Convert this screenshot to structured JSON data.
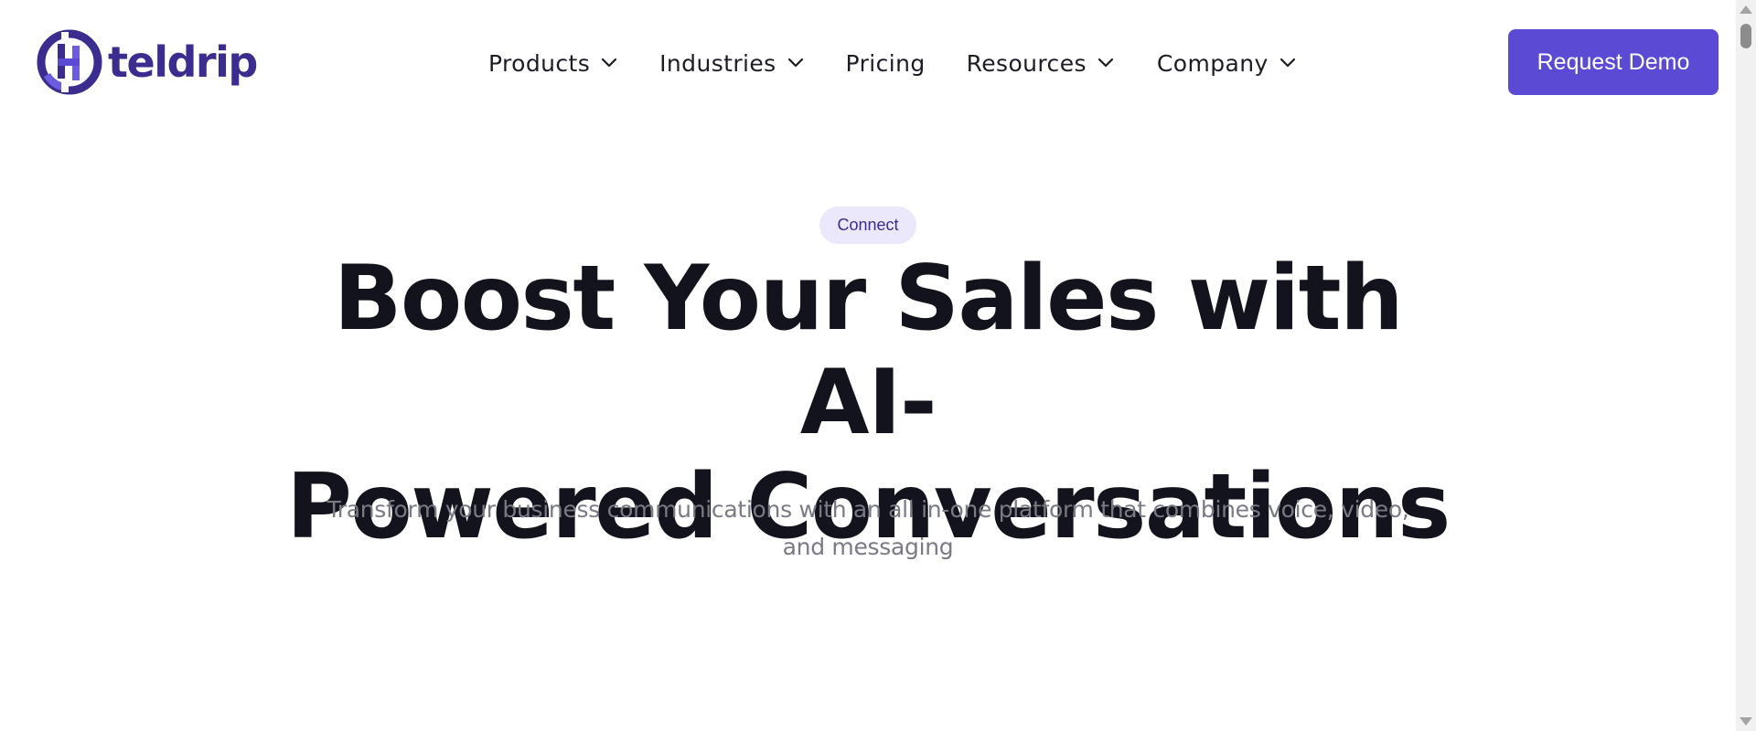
{
  "header": {
    "logo_text": "teldrip",
    "nav": [
      {
        "label": "Products",
        "has_dropdown": true
      },
      {
        "label": "Industries",
        "has_dropdown": true
      },
      {
        "label": "Pricing",
        "has_dropdown": false
      },
      {
        "label": "Resources",
        "has_dropdown": true
      },
      {
        "label": "Company",
        "has_dropdown": true
      }
    ],
    "cta_label": "Request Demo"
  },
  "hero": {
    "badge": "Connect",
    "headline_line1": "Boost Your Sales with AI-",
    "headline_line2": "Powered Conversations",
    "subtitle_line1": "Transform your business communications with an all in-one platform that combines voice, video,",
    "subtitle_line2": "and messaging"
  },
  "colors": {
    "brand": "#3a2d8f",
    "accent": "#5b4bd4",
    "badge_bg": "#ebe8fc",
    "headline": "#13131d",
    "subtitle": "#7a7a85"
  },
  "icons": {
    "logo": "teldrip-logo-icon",
    "dropdown": "chevron-down-icon"
  }
}
